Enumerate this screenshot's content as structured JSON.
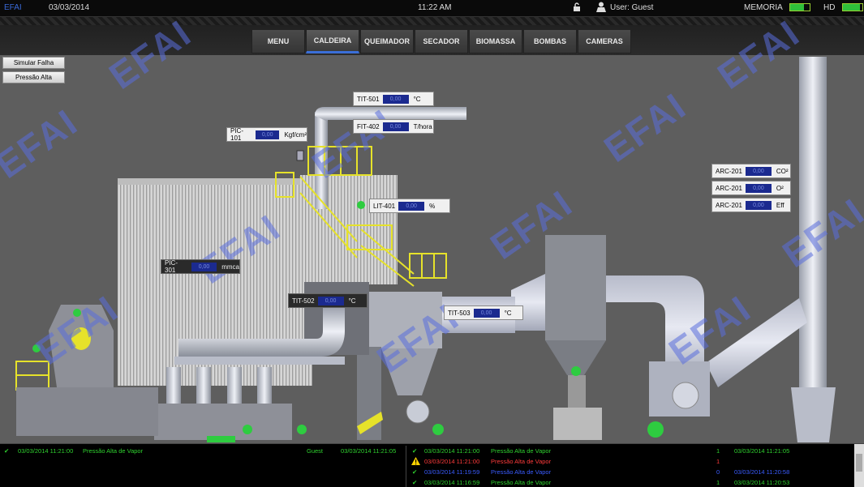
{
  "statusbar": {
    "app": "EFAI",
    "date": "03/03/2014",
    "time": "11:22 AM",
    "user": "User: Guest",
    "memoria_label": "MEMORIA",
    "hd_label": "HD",
    "memoria_fill_pct": 70,
    "hd_fill_pct": 85
  },
  "nav": {
    "tabs": [
      "MENU",
      "CALDEIRA",
      "QUEIMADOR",
      "SECADOR",
      "BIOMASSA",
      "BOMBAS",
      "CAMERAS"
    ],
    "active": "CALDEIRA"
  },
  "buttons": {
    "simular": "Simular Falha",
    "pressao": "Pressão Alta"
  },
  "tags": {
    "tit501": {
      "id": "TIT-501",
      "value": "0,00",
      "unit": "°C"
    },
    "fit402": {
      "id": "FIT-402",
      "value": "0,00",
      "unit": "T/hora"
    },
    "pic101": {
      "id": "PIC-101",
      "value": "0,00",
      "unit": "Kgf/cm²"
    },
    "lit401": {
      "id": "LIT-401",
      "value": "0,00",
      "unit": "%"
    },
    "pic301": {
      "id": "PIC-301",
      "value": "0,00",
      "unit": "mmca"
    },
    "tit502": {
      "id": "TIT-502",
      "value": "0,00",
      "unit": "°C"
    },
    "tit503": {
      "id": "TIT-503",
      "value": "0,00",
      "unit": "°C"
    },
    "arc201a": {
      "id": "ARC-201",
      "value": "0,00",
      "unit": "CO²"
    },
    "arc201b": {
      "id": "ARC-201",
      "value": "0,00",
      "unit": "O²"
    },
    "arc201c": {
      "id": "ARC-201",
      "value": "0,00",
      "unit": "Eff"
    }
  },
  "watermark": "EFAI",
  "alarms_left": [
    {
      "time": "03/03/2014 11:21:00",
      "msg": "Pressão Alta de Vapor",
      "user": "Guest",
      "ack": "03/03/2014 11:21:05"
    }
  ],
  "alarms_right": [
    {
      "time": "03/03/2014 11:21:00",
      "msg": "Pressão Alta de Vapor",
      "count": "1",
      "ack": "03/03/2014 11:21:05",
      "color": "#2fd22f",
      "icon": "check"
    },
    {
      "time": "03/03/2014 11:21:00",
      "msg": "Pressão Alta de Vapor",
      "count": "1",
      "ack": "",
      "color": "#ff3b3b",
      "icon": "warning"
    },
    {
      "time": "03/03/2014 11:19:59",
      "msg": "Pressão Alta de Vapor",
      "count": "0",
      "ack": "03/03/2014 11:20:58",
      "color": "#3a5cff",
      "icon": "check"
    },
    {
      "time": "03/03/2014 11:16:59",
      "msg": "Pressão Alta de Vapor",
      "count": "1",
      "ack": "03/03/2014 11:20:53",
      "color": "#2fd22f",
      "icon": "check"
    }
  ]
}
